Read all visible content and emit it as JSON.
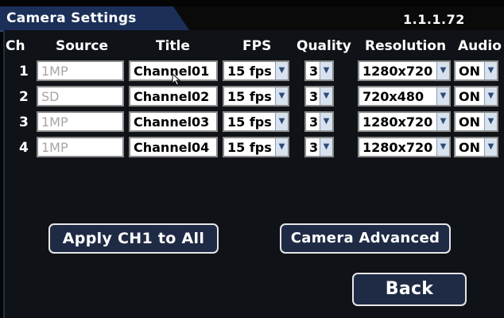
{
  "header": {
    "tab_title": "Camera Settings",
    "version": "1.1.1.72"
  },
  "columns": {
    "ch": "Ch",
    "source": "Source",
    "title": "Title",
    "fps": "FPS",
    "quality": "Quality",
    "resolution": "Resolution",
    "audio": "Audio"
  },
  "rows": [
    {
      "ch": "1",
      "source": "1MP",
      "title": "Channel01",
      "fps": "15 fps",
      "quality": "3",
      "resolution": "1280x720",
      "audio": "ON"
    },
    {
      "ch": "2",
      "source": "SD",
      "title": "Channel02",
      "fps": "15 fps",
      "quality": "3",
      "resolution": "720x480",
      "audio": "ON"
    },
    {
      "ch": "3",
      "source": "1MP",
      "title": "Channel03",
      "fps": "15 fps",
      "quality": "3",
      "resolution": "1280x720",
      "audio": "ON"
    },
    {
      "ch": "4",
      "source": "1MP",
      "title": "Channel04",
      "fps": "15 fps",
      "quality": "3",
      "resolution": "1280x720",
      "audio": "ON"
    }
  ],
  "buttons": {
    "apply_all": "Apply CH1 to All",
    "advanced": "Camera Advanced",
    "back": "Back"
  },
  "icons": {
    "dropdown": "dropdown-arrow-icon",
    "cursor": "mouse-cursor-icon"
  },
  "colors": {
    "tab_bg": "#1b2f58",
    "button_bg": "#1f2b45",
    "panel_bg": "#0f1217",
    "dropdown_bg": "#d8e2ee"
  }
}
